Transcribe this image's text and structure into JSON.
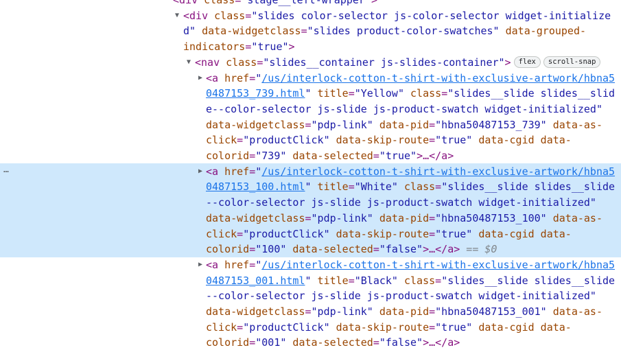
{
  "selected_node_marker": "…",
  "colors": {
    "tag": "#881280",
    "attr_name": "#994500",
    "attr_value": "#1a1aa6",
    "link": "#1a73e8",
    "selected_bg": "#cfe8fc"
  },
  "lines": [
    {
      "indent": 0,
      "tri": "",
      "segs": [
        [
          "p",
          "<div "
        ],
        [
          "n",
          "class"
        ],
        [
          "p",
          "="
        ],
        [
          "v",
          "\"stage__left-wrapper\""
        ],
        [
          "p",
          ">"
        ]
      ]
    },
    {
      "indent": 1,
      "tri": "expanded",
      "segs": [
        [
          "p",
          "<div "
        ],
        [
          "n",
          "class"
        ],
        [
          "p",
          "="
        ],
        [
          "v",
          "\"slides color-selector js-color-selector widget-initialize"
        ]
      ]
    },
    {
      "indent": 1,
      "tri": "",
      "segs": [
        [
          "v",
          "d\""
        ],
        [
          "n",
          " data-widgetclass"
        ],
        [
          "p",
          "="
        ],
        [
          "v",
          "\"slides product-color-swatches\""
        ],
        [
          "n",
          " data-grouped-"
        ]
      ]
    },
    {
      "indent": 1,
      "tri": "",
      "segs": [
        [
          "n",
          "indicators"
        ],
        [
          "p",
          "="
        ],
        [
          "v",
          "\"true\""
        ],
        [
          "p",
          ">"
        ]
      ]
    },
    {
      "indent": 2,
      "tri": "expanded",
      "segs": [
        [
          "p",
          "<nav "
        ],
        [
          "n",
          "class"
        ],
        [
          "p",
          "="
        ],
        [
          "v",
          "\"slides__container js-slides-container\""
        ],
        [
          "p",
          ">"
        ]
      ],
      "badges": [
        "flex",
        "scroll-snap"
      ]
    },
    {
      "indent": 3,
      "tri": "collapsed",
      "segs": [
        [
          "p",
          "<a "
        ],
        [
          "n",
          "href"
        ],
        [
          "p",
          "="
        ],
        [
          "v",
          "\""
        ],
        [
          "l",
          "/us/interlock-cotton-t-shirt-with-exclusive-artwork/hbna5"
        ]
      ]
    },
    {
      "indent": 3,
      "tri": "",
      "segs": [
        [
          "l",
          "0487153_739.html"
        ],
        [
          "v",
          "\""
        ],
        [
          "n",
          " title"
        ],
        [
          "p",
          "="
        ],
        [
          "v",
          "\"Yellow\""
        ],
        [
          "n",
          " class"
        ],
        [
          "p",
          "="
        ],
        [
          "v",
          "\"slides__slide slides__slid"
        ]
      ]
    },
    {
      "indent": 3,
      "tri": "",
      "segs": [
        [
          "v",
          "e--color-selector js-slide js-product-swatch widget-initialized\""
        ]
      ]
    },
    {
      "indent": 3,
      "tri": "",
      "segs": [
        [
          "n",
          "data-widgetclass"
        ],
        [
          "p",
          "="
        ],
        [
          "v",
          "\"pdp-link\""
        ],
        [
          "n",
          " data-pid"
        ],
        [
          "p",
          "="
        ],
        [
          "v",
          "\"hbna50487153_739\""
        ],
        [
          "n",
          " data-as-"
        ]
      ]
    },
    {
      "indent": 3,
      "tri": "",
      "segs": [
        [
          "n",
          "click"
        ],
        [
          "p",
          "="
        ],
        [
          "v",
          "\"productClick\""
        ],
        [
          "n",
          " data-skip-route"
        ],
        [
          "p",
          "="
        ],
        [
          "v",
          "\"true\""
        ],
        [
          "n",
          " data-cgid data-"
        ]
      ]
    },
    {
      "indent": 3,
      "tri": "",
      "segs": [
        [
          "n",
          "colorid"
        ],
        [
          "p",
          "="
        ],
        [
          "v",
          "\"739\""
        ],
        [
          "n",
          " data-selected"
        ],
        [
          "p",
          "="
        ],
        [
          "v",
          "\"true\""
        ],
        [
          "p",
          ">…</a>"
        ]
      ]
    },
    {
      "indent": 3,
      "tri": "collapsed",
      "segs": [
        [
          "p",
          "<a "
        ],
        [
          "n",
          "href"
        ],
        [
          "p",
          "="
        ],
        [
          "v",
          "\""
        ],
        [
          "l",
          "/us/interlock-cotton-t-shirt-with-exclusive-artwork/hbna5"
        ]
      ]
    },
    {
      "indent": 3,
      "tri": "",
      "segs": [
        [
          "l",
          "0487153_100.html"
        ],
        [
          "v",
          "\""
        ],
        [
          "n",
          " title"
        ],
        [
          "p",
          "="
        ],
        [
          "v",
          "\"White\""
        ],
        [
          "n",
          " class"
        ],
        [
          "p",
          "="
        ],
        [
          "v",
          "\"slides__slide slides__slide"
        ]
      ]
    },
    {
      "indent": 3,
      "tri": "",
      "segs": [
        [
          "v",
          "--color-selector js-slide js-product-swatch widget-initialized\""
        ]
      ]
    },
    {
      "indent": 3,
      "tri": "",
      "segs": [
        [
          "n",
          "data-widgetclass"
        ],
        [
          "p",
          "="
        ],
        [
          "v",
          "\"pdp-link\""
        ],
        [
          "n",
          " data-pid"
        ],
        [
          "p",
          "="
        ],
        [
          "v",
          "\"hbna50487153_100\""
        ],
        [
          "n",
          " data-as-"
        ]
      ]
    },
    {
      "indent": 3,
      "tri": "",
      "segs": [
        [
          "n",
          "click"
        ],
        [
          "p",
          "="
        ],
        [
          "v",
          "\"productClick\""
        ],
        [
          "n",
          " data-skip-route"
        ],
        [
          "p",
          "="
        ],
        [
          "v",
          "\"true\""
        ],
        [
          "n",
          " data-cgid data-"
        ]
      ]
    },
    {
      "indent": 3,
      "tri": "",
      "segs": [
        [
          "n",
          "colorid"
        ],
        [
          "p",
          "="
        ],
        [
          "v",
          "\"100\""
        ],
        [
          "n",
          " data-selected"
        ],
        [
          "p",
          "="
        ],
        [
          "v",
          "\"false\""
        ],
        [
          "p",
          ">…</a>"
        ],
        [
          "g",
          " == $0"
        ]
      ]
    },
    {
      "indent": 3,
      "tri": "collapsed",
      "segs": [
        [
          "p",
          "<a "
        ],
        [
          "n",
          "href"
        ],
        [
          "p",
          "="
        ],
        [
          "v",
          "\""
        ],
        [
          "l",
          "/us/interlock-cotton-t-shirt-with-exclusive-artwork/hbna5"
        ]
      ]
    },
    {
      "indent": 3,
      "tri": "",
      "segs": [
        [
          "l",
          "0487153_001.html"
        ],
        [
          "v",
          "\""
        ],
        [
          "n",
          " title"
        ],
        [
          "p",
          "="
        ],
        [
          "v",
          "\"Black\""
        ],
        [
          "n",
          " class"
        ],
        [
          "p",
          "="
        ],
        [
          "v",
          "\"slides__slide slides__slide"
        ]
      ]
    },
    {
      "indent": 3,
      "tri": "",
      "segs": [
        [
          "v",
          "--color-selector js-slide js-product-swatch widget-initialized\""
        ]
      ]
    },
    {
      "indent": 3,
      "tri": "",
      "segs": [
        [
          "n",
          "data-widgetclass"
        ],
        [
          "p",
          "="
        ],
        [
          "v",
          "\"pdp-link\""
        ],
        [
          "n",
          " data-pid"
        ],
        [
          "p",
          "="
        ],
        [
          "v",
          "\"hbna50487153_001\""
        ],
        [
          "n",
          " data-as-"
        ]
      ]
    },
    {
      "indent": 3,
      "tri": "",
      "segs": [
        [
          "n",
          "click"
        ],
        [
          "p",
          "="
        ],
        [
          "v",
          "\"productClick\""
        ],
        [
          "n",
          " data-skip-route"
        ],
        [
          "p",
          "="
        ],
        [
          "v",
          "\"true\""
        ],
        [
          "n",
          " data-cgid data-"
        ]
      ]
    },
    {
      "indent": 3,
      "tri": "",
      "segs": [
        [
          "n",
          "colorid"
        ],
        [
          "p",
          "="
        ],
        [
          "v",
          "\"001\""
        ],
        [
          "n",
          " data-selected"
        ],
        [
          "p",
          "="
        ],
        [
          "v",
          "\"false\""
        ],
        [
          "p",
          ">…</a>"
        ]
      ]
    }
  ]
}
